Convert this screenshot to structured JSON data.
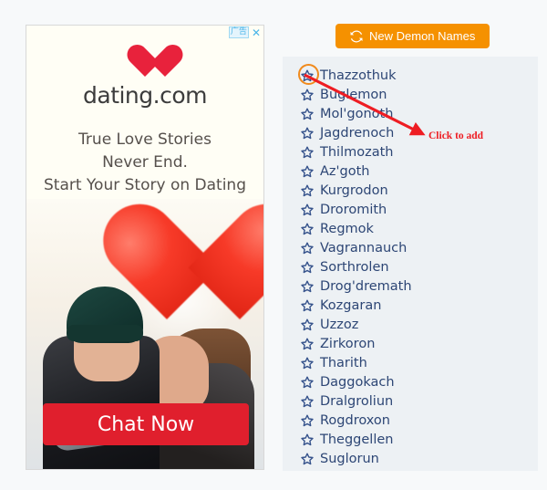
{
  "page": {
    "background_color": "#f7f9fa"
  },
  "ad": {
    "label_tag": "广告",
    "close_label": "✕",
    "brand": "dating.com",
    "headline": "True Love Stories\nNever End.\nStart Your Story on Dating",
    "cta_label": "Chat Now",
    "cta_color": "#e01f2d",
    "heart_color": "#e8223c",
    "background_color": "#fffef5"
  },
  "toolbar": {
    "generate_label": "New Demon Names",
    "generate_icon": "refresh-icon",
    "accent_color": "#f59100"
  },
  "annotation": {
    "text": "Click to add",
    "color": "#ee1d23",
    "highlight_color": "#f08a1c"
  },
  "names_panel": {
    "background_color": "#edf1f4",
    "text_color": "#2d4675",
    "star_icon": "star-outline-icon",
    "items": [
      {
        "name": "Thazzothuk"
      },
      {
        "name": "Buglemon"
      },
      {
        "name": "Mol'gonoth"
      },
      {
        "name": "Jagdrenoch"
      },
      {
        "name": "Thilmozath"
      },
      {
        "name": "Az'goth"
      },
      {
        "name": "Kurgrodon"
      },
      {
        "name": "Droromith"
      },
      {
        "name": "Regmok"
      },
      {
        "name": "Vagrannauch"
      },
      {
        "name": "Sorthrolen"
      },
      {
        "name": "Drog'dremath"
      },
      {
        "name": "Kozgaran"
      },
      {
        "name": "Uzzoz"
      },
      {
        "name": "Zirkoron"
      },
      {
        "name": "Tharith"
      },
      {
        "name": "Daggokach"
      },
      {
        "name": "Dralgroliun"
      },
      {
        "name": "Rogdroxon"
      },
      {
        "name": "Theggellen"
      },
      {
        "name": "Suglorun"
      }
    ]
  }
}
